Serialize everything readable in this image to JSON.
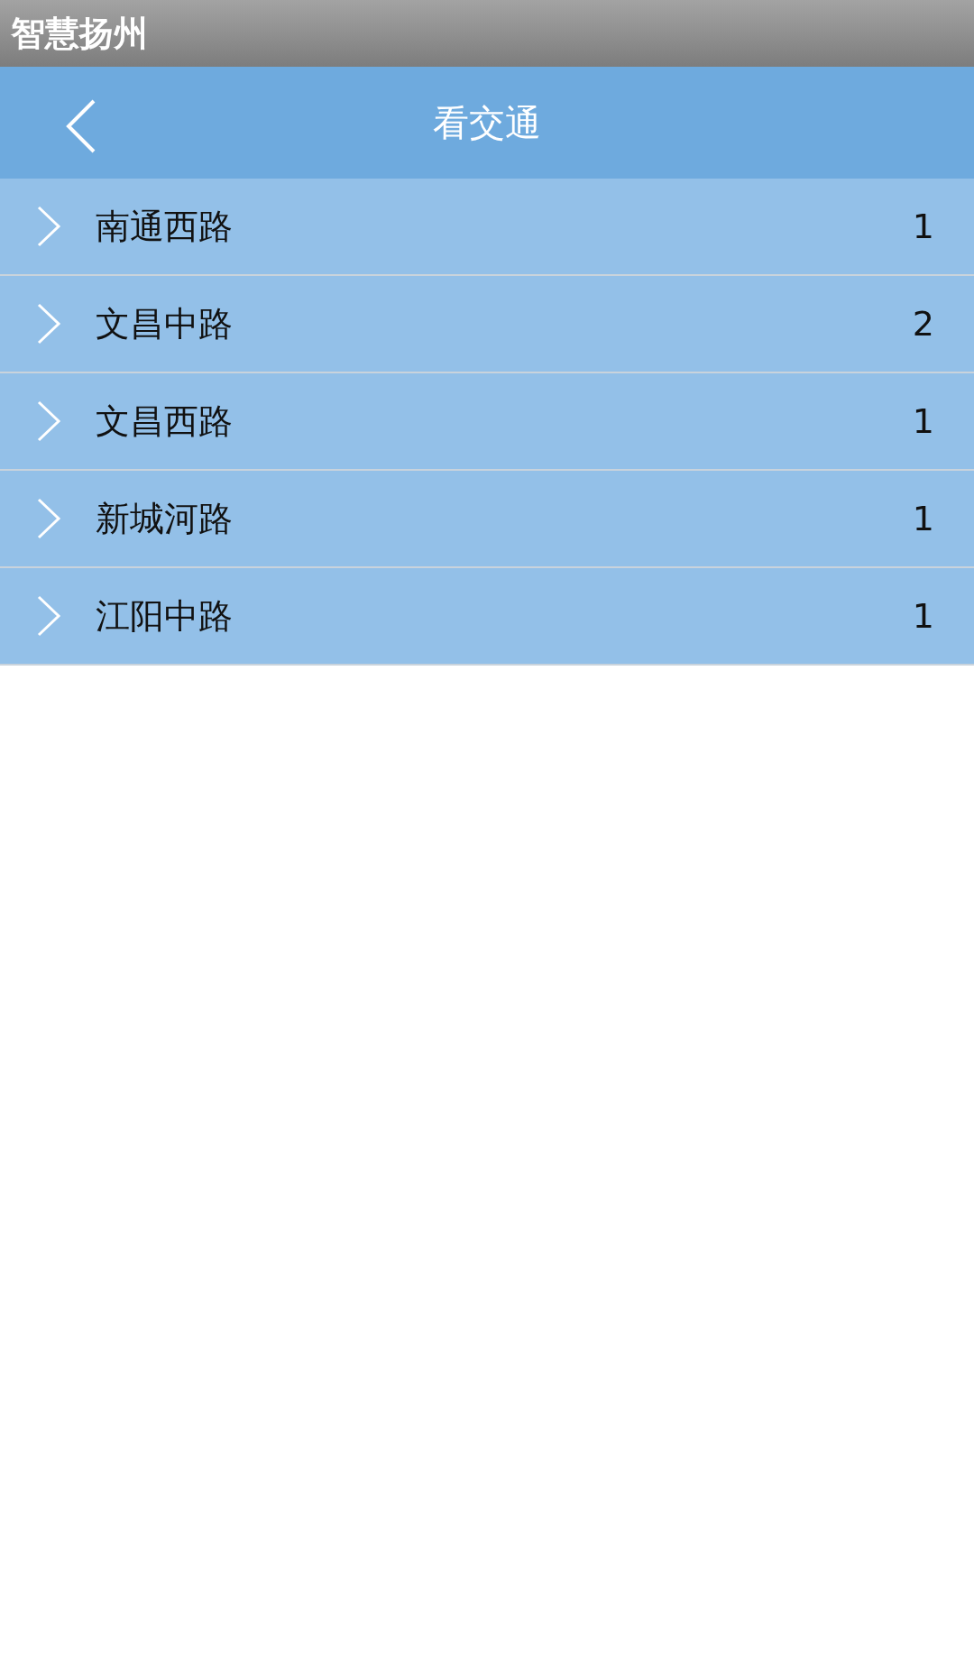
{
  "app_bar": {
    "title": "智慧扬州"
  },
  "header": {
    "title": "看交通"
  },
  "roads": [
    {
      "name": "南通西路",
      "count": "1"
    },
    {
      "name": "文昌中路",
      "count": "2"
    },
    {
      "name": "文昌西路",
      "count": "1"
    },
    {
      "name": "新城河路",
      "count": "1"
    },
    {
      "name": "江阳中路",
      "count": "1"
    }
  ]
}
